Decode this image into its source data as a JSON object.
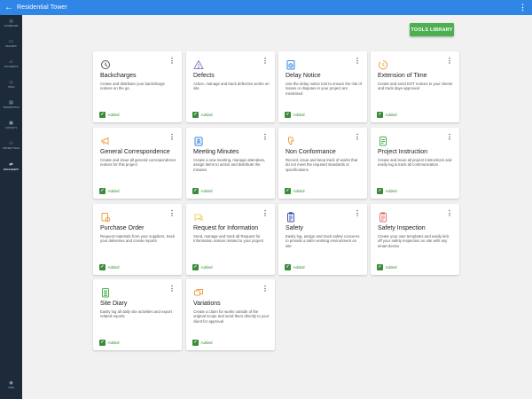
{
  "header": {
    "back_icon": "arrow-left-icon",
    "title": "Residential Tower",
    "more_icon": "more-vert-icon"
  },
  "sidebar": {
    "items": [
      {
        "label": "DASHBOARD",
        "icon": "dashboard-icon",
        "glyph": "◎"
      },
      {
        "label": "RECORDS",
        "icon": "folder-icon",
        "glyph": "▭"
      },
      {
        "label": "DOCUMENTS",
        "icon": "documents-icon",
        "glyph": "▱"
      },
      {
        "label": "TASKS",
        "icon": "tasks-icon",
        "glyph": "◇"
      },
      {
        "label": "TRANSMITTALS",
        "icon": "transmittals-icon",
        "glyph": "▤"
      },
      {
        "label": "CONTACTS",
        "icon": "contacts-icon",
        "glyph": "▣"
      },
      {
        "label": "PROJECT TEAM",
        "icon": "team-icon",
        "glyph": "⚇"
      },
      {
        "label": "MANAGEMENT",
        "icon": "management-icon",
        "glyph": "⇄"
      }
    ],
    "active_index": 7,
    "footer": {
      "label": "USER",
      "icon": "user-icon",
      "glyph": "◉"
    }
  },
  "tools_library_label": "TOOLS LIBRARY",
  "added_label": "Added",
  "cards": [
    {
      "title": "Backcharges",
      "description": "Create and distribute your backcharge notices on the go",
      "icon": "backcharge-icon",
      "color": "#555555"
    },
    {
      "title": "Defects",
      "description": "Action, manage and track defective works on site",
      "icon": "warning-icon",
      "color": "#8e7cc3"
    },
    {
      "title": "Delay Notice",
      "description": "Use the delay notice tool to ensure the risk of losses or disputes in your project are minimised",
      "icon": "delay-icon",
      "color": "#2f86e6"
    },
    {
      "title": "Extension of Time",
      "description": "Create and send EOT notices to your clients and track days approved",
      "icon": "time-icon",
      "color": "#f0a040"
    },
    {
      "title": "General Correspondence",
      "description": "Create and issue all general correspondence notices for this project",
      "icon": "megaphone-icon",
      "color": "#f0a040"
    },
    {
      "title": "Meeting Minutes",
      "description": "Create a new meeting, manage attendees, assign items to action and distribute the minutes",
      "icon": "meeting-icon",
      "color": "#2f86e6"
    },
    {
      "title": "Non Conformance",
      "description": "Record, issue and keep track of works that do not meet the required standards or specifications",
      "icon": "thumbs-down-icon",
      "color": "#f0a040"
    },
    {
      "title": "Project Instruction",
      "description": "Create and issue all project instructions and easily log & track all communication",
      "icon": "instruction-icon",
      "color": "#4caf50"
    },
    {
      "title": "Purchase Order",
      "description": "Request materials from your suppliers, track your deliveries and create reports",
      "icon": "purchase-icon",
      "color": "#f0a040"
    },
    {
      "title": "Request for Information",
      "description": "Send, manage and track all Request for Information notices related to your project",
      "icon": "chat-icon",
      "color": "#f5d060"
    },
    {
      "title": "Safety",
      "description": "Easily log, assign and track safety concerns to provide a safer working environment on site",
      "icon": "safety-icon",
      "color": "#3f51b5"
    },
    {
      "title": "Safety Inspection",
      "description": "Create your own templates and easily kick off your safety inspection on site with any smart device",
      "icon": "inspection-icon",
      "color": "#e57373"
    },
    {
      "title": "Site Diary",
      "description": "Easily log all daily site activities and export related reports",
      "icon": "diary-icon",
      "color": "#4caf50"
    },
    {
      "title": "Variations",
      "description": "Create a claim for works outside of the original scope and send them directly to your client for approval",
      "icon": "variations-icon",
      "color": "#f0a040"
    }
  ]
}
